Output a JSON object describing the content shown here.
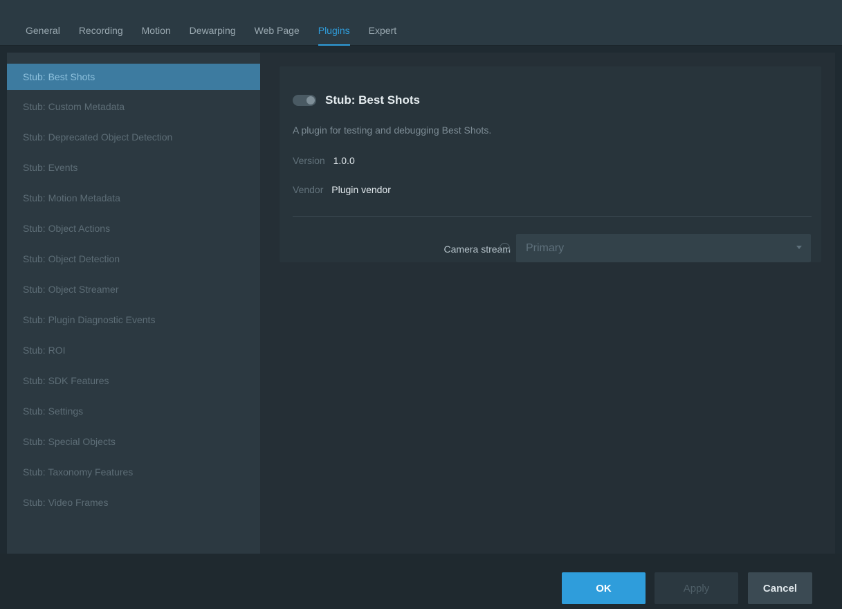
{
  "tabs": [
    {
      "label": "General"
    },
    {
      "label": "Recording"
    },
    {
      "label": "Motion"
    },
    {
      "label": "Dewarping"
    },
    {
      "label": "Web Page"
    },
    {
      "label": "Plugins"
    },
    {
      "label": "Expert"
    }
  ],
  "active_tab": "Plugins",
  "sidebar": {
    "items": [
      {
        "label": "Stub: Best Shots"
      },
      {
        "label": "Stub: Custom Metadata"
      },
      {
        "label": "Stub: Deprecated Object Detection"
      },
      {
        "label": "Stub: Events"
      },
      {
        "label": "Stub: Motion Metadata"
      },
      {
        "label": "Stub: Object Actions"
      },
      {
        "label": "Stub: Object Detection"
      },
      {
        "label": "Stub: Object Streamer"
      },
      {
        "label": "Stub: Plugin Diagnostic Events"
      },
      {
        "label": "Stub: ROI"
      },
      {
        "label": "Stub: SDK Features"
      },
      {
        "label": "Stub: Settings"
      },
      {
        "label": "Stub: Special Objects"
      },
      {
        "label": "Stub: Taxonomy Features"
      },
      {
        "label": "Stub: Video Frames"
      }
    ],
    "selected_index": 0
  },
  "plugin": {
    "title": "Stub: Best Shots",
    "enabled": false,
    "description": "A plugin for testing and debugging Best Shots.",
    "version_label": "Version",
    "version": "1.0.0",
    "vendor_label": "Vendor",
    "vendor": "Plugin vendor"
  },
  "camera_stream": {
    "label": "Camera stream",
    "help_icon": "help-circle-icon",
    "value": "Primary"
  },
  "footer": {
    "ok_label": "OK",
    "apply_label": "Apply",
    "cancel_label": "Cancel"
  },
  "colors": {
    "accent": "#2f9ddb",
    "selected_item": "#3d7ba0"
  }
}
